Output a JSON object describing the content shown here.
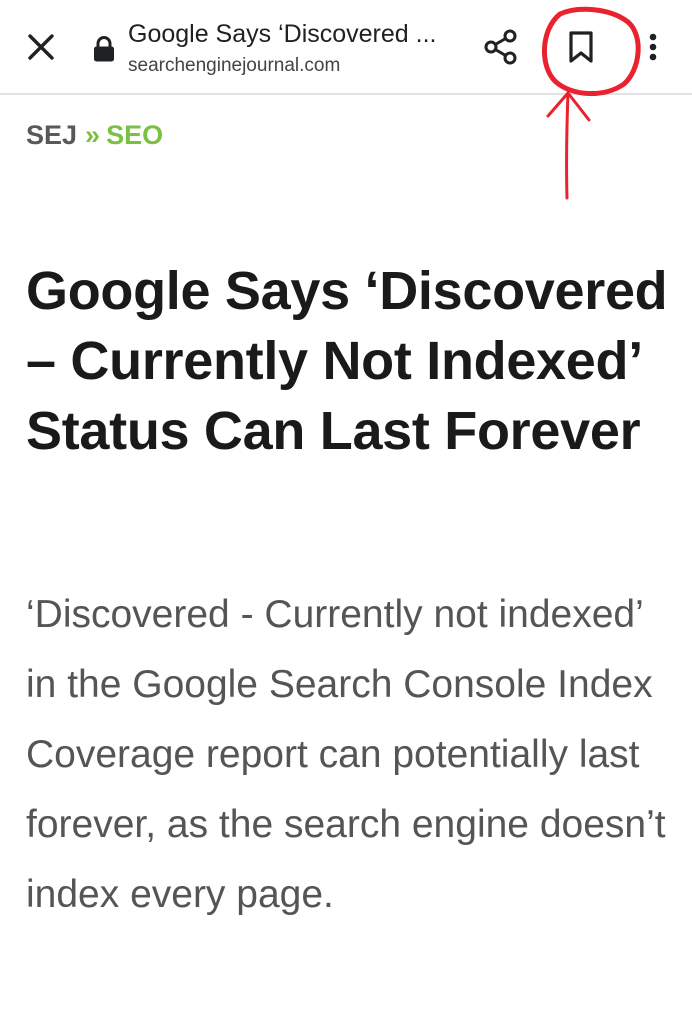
{
  "browser": {
    "page_title": "Google Says ‘Discovered ...",
    "url": "searchenginejournal.com",
    "icons": {
      "close": "close-icon",
      "lock": "lock-icon",
      "share": "share-icon",
      "bookmark": "bookmark-icon",
      "menu": "more-vert-icon"
    }
  },
  "breadcrumb": {
    "home": "SEJ",
    "separator": "»",
    "current": "SEO"
  },
  "article": {
    "headline": "Google Says ‘Discovered – Currently Not Indexed’ Status Can Last Forever",
    "summary": "‘Discovered - Currently not indexed’ in the Google Search Console Index Coverage report can potentially last forever, as the search engine doesn’t index every page."
  },
  "colors": {
    "brand_green": "#7ac143",
    "annotation_red": "#e8232f",
    "headline": "#1a1a1a",
    "summary": "#555555"
  }
}
